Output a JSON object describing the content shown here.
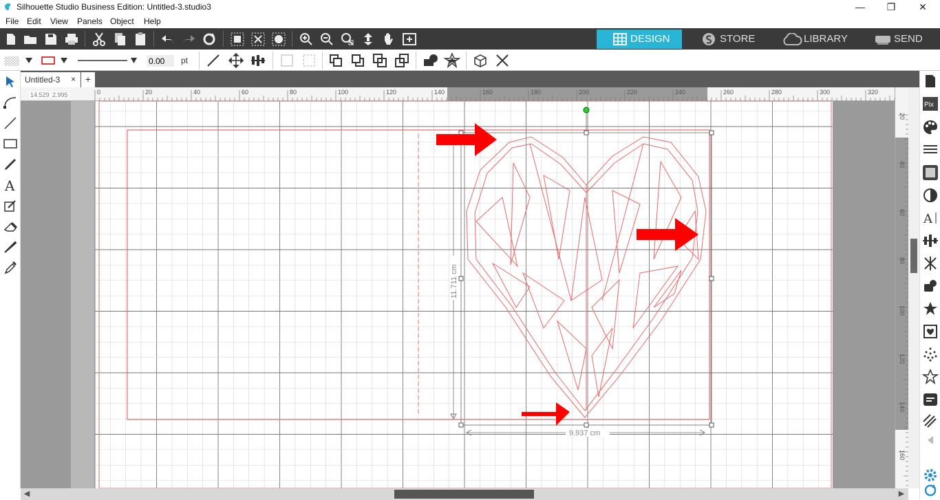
{
  "window": {
    "title": "Silhouette Studio Business Edition: Untitled-3.studio3",
    "minimize": "—",
    "restore": "❐",
    "close": "✕"
  },
  "menu": [
    "File",
    "Edit",
    "View",
    "Panels",
    "Object",
    "Help"
  ],
  "nav_tabs": [
    {
      "label": "DESIGN",
      "icon": "grid-icon",
      "active": true
    },
    {
      "label": "STORE",
      "icon": "store-s-icon",
      "active": false
    },
    {
      "label": "LIBRARY",
      "icon": "cloud-icon",
      "active": false
    },
    {
      "label": "SEND",
      "icon": "cutter-icon",
      "active": false
    }
  ],
  "properties": {
    "line_width": "0.00",
    "line_unit": "pt"
  },
  "document_tab": {
    "label": "Untitled-3",
    "close": "×",
    "new_tab": "+"
  },
  "coordinates": {
    "x": "14.529",
    "y": "2.995"
  },
  "ruler": {
    "top_ticks": [
      "0",
      "20",
      "40",
      "60",
      "80",
      "100",
      "120",
      "140",
      "160",
      "180",
      "200",
      "220",
      "240",
      "260",
      "280",
      "300",
      "320"
    ],
    "side_ticks": [
      "20",
      "40",
      "60",
      "80",
      "100",
      "120",
      "140",
      "160"
    ]
  },
  "dimensions": {
    "height_label": "11.711 cm",
    "width_label": "9.937 cm"
  },
  "colors": {
    "accent": "#29b6d6",
    "toolbar_bg": "#3a3a3a",
    "cut_line": "#e86a6a",
    "arrow": "#ff0000",
    "page_bg": "#ffffff",
    "canvas_bg": "#9a9a9a"
  }
}
